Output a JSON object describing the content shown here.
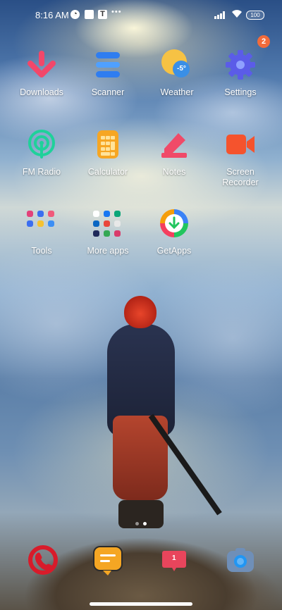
{
  "status_bar": {
    "time": "8:16 AM",
    "notification_icons": [
      "app-notification-icon",
      "gallery-notification-icon",
      "tv-notification-icon"
    ],
    "more_indicator": "•••",
    "battery": "100"
  },
  "home": {
    "apps": [
      {
        "label": "Downloads",
        "icon": "download-arrow-icon"
      },
      {
        "label": "Scanner",
        "icon": "scanner-icon"
      },
      {
        "label": "Weather",
        "icon": "weather-icon",
        "weather_temp": "-5°"
      },
      {
        "label": "Settings",
        "icon": "gear-icon",
        "badge": "2"
      },
      {
        "label": "FM Radio",
        "icon": "radio-icon"
      },
      {
        "label": "Calculator",
        "icon": "calculator-icon"
      },
      {
        "label": "Notes",
        "icon": "pencil-icon"
      },
      {
        "label": "Screen\nRecorder",
        "icon": "video-camera-icon"
      },
      {
        "label": "Tools",
        "icon": "folder-icon"
      },
      {
        "label": "More apps",
        "icon": "folder-icon"
      },
      {
        "label": "GetApps",
        "icon": "getapps-icon"
      }
    ]
  },
  "page_indicator": {
    "pages": 2,
    "active": 1
  },
  "dock": {
    "apps": [
      {
        "icon": "phone-icon"
      },
      {
        "icon": "messages-icon"
      },
      {
        "icon": "themes-icon",
        "badge": "1"
      },
      {
        "icon": "camera-icon"
      }
    ]
  },
  "colors": {
    "downloads": "#f2476a",
    "scanner": "#2f7df0",
    "weather": "#f6c244",
    "settings": "#5b5ce8",
    "fm_radio": "#1fd19a",
    "calculator": "#f6a623",
    "notes": "#f04a68",
    "recorder": "#f5532d",
    "badge": "#f26b3a"
  }
}
